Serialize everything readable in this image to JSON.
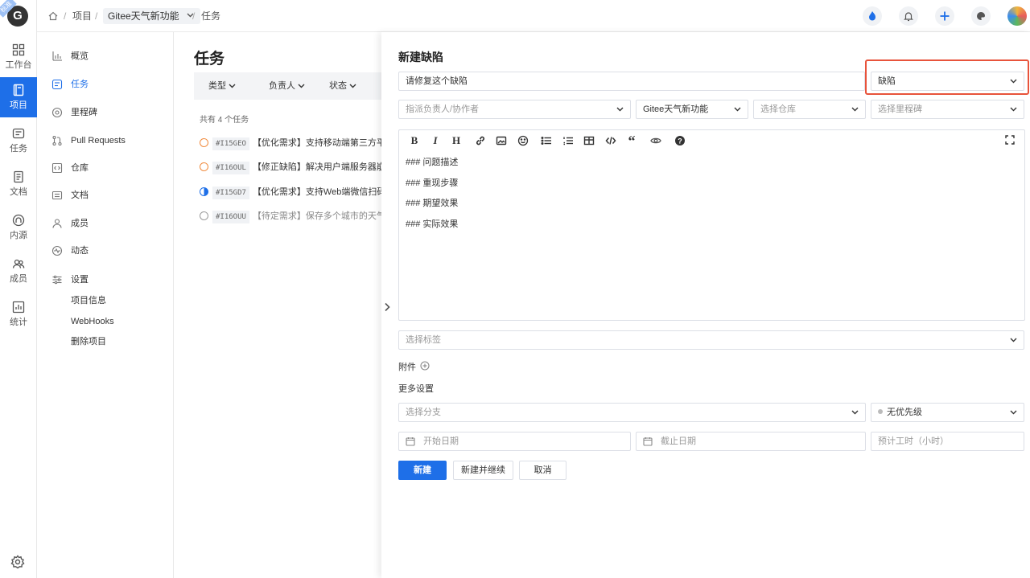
{
  "colors": {
    "accent": "#1e6fe8",
    "highlight": "#e8533b"
  },
  "rail": {
    "logo": "G",
    "ribbon": "标准",
    "items": [
      {
        "label": "工作台",
        "icon": "grid-icon"
      },
      {
        "label": "项目",
        "icon": "book-icon",
        "active": true
      },
      {
        "label": "任务",
        "icon": "task-icon"
      },
      {
        "label": "文档",
        "icon": "doc-icon"
      },
      {
        "label": "内源",
        "icon": "source-icon"
      },
      {
        "label": "成员",
        "icon": "members-icon"
      },
      {
        "label": "统计",
        "icon": "stats-icon"
      }
    ]
  },
  "breadcrumb": {
    "project": "项目",
    "project_name": "Gitee天气新功能",
    "current": "任务"
  },
  "sidenav": {
    "items": [
      {
        "label": "概览",
        "icon": "bar-chart-icon"
      },
      {
        "label": "任务",
        "icon": "task-icon",
        "active": true
      },
      {
        "label": "里程碑",
        "icon": "milestone-icon"
      },
      {
        "label": "Pull Requests",
        "icon": "pull-request-icon"
      },
      {
        "label": "仓库",
        "icon": "code-icon"
      },
      {
        "label": "文档",
        "icon": "doc-icon"
      },
      {
        "label": "成员",
        "icon": "user-icon"
      },
      {
        "label": "动态",
        "icon": "activity-icon"
      },
      {
        "label": "设置",
        "icon": "settings-icon"
      }
    ],
    "settings_sub": [
      "项目信息",
      "WebHooks",
      "删除项目"
    ]
  },
  "main": {
    "title": "任务",
    "filters": [
      "类型",
      "负责人",
      "状态"
    ],
    "count": "共有 4 个任务",
    "tasks": [
      {
        "id": "#I15GEO",
        "title": "【优化需求】支持移动端第三方平",
        "status": "open",
        "color": "#f08a3c"
      },
      {
        "id": "#I16OUL",
        "title": "【修正缺陷】解决用户端服务器崩",
        "status": "open",
        "color": "#f08a3c"
      },
      {
        "id": "#I15GD7",
        "title": "【优化需求】支持Web端微信扫码",
        "status": "progress",
        "color": "#1e6fe8"
      },
      {
        "id": "#I16OUU",
        "title": "【待定需求】保存多个城市的天气",
        "status": "done",
        "color": "#999999"
      }
    ]
  },
  "drawer": {
    "title": "新建缺陷",
    "title_input": "请修复这个缺陷",
    "type_select": "缺陷",
    "assignee_placeholder": "指派负责人/协作者",
    "project_select": "Gitee天气新功能",
    "repo_placeholder": "选择仓库",
    "milestone_placeholder": "选择里程碑",
    "editor_lines": [
      "### 问题描述",
      "### 重现步骤",
      "### 期望效果",
      "### 实际效果"
    ],
    "label_placeholder": "选择标签",
    "attachment_label": "附件",
    "more_settings": "更多设置",
    "branch_placeholder": "选择分支",
    "priority": "无优先级",
    "start_date": "开始日期",
    "due_date": "截止日期",
    "estimate_placeholder": "预计工时（小时）",
    "buttons": {
      "create": "新建",
      "create_continue": "新建并继续",
      "cancel": "取消"
    }
  }
}
